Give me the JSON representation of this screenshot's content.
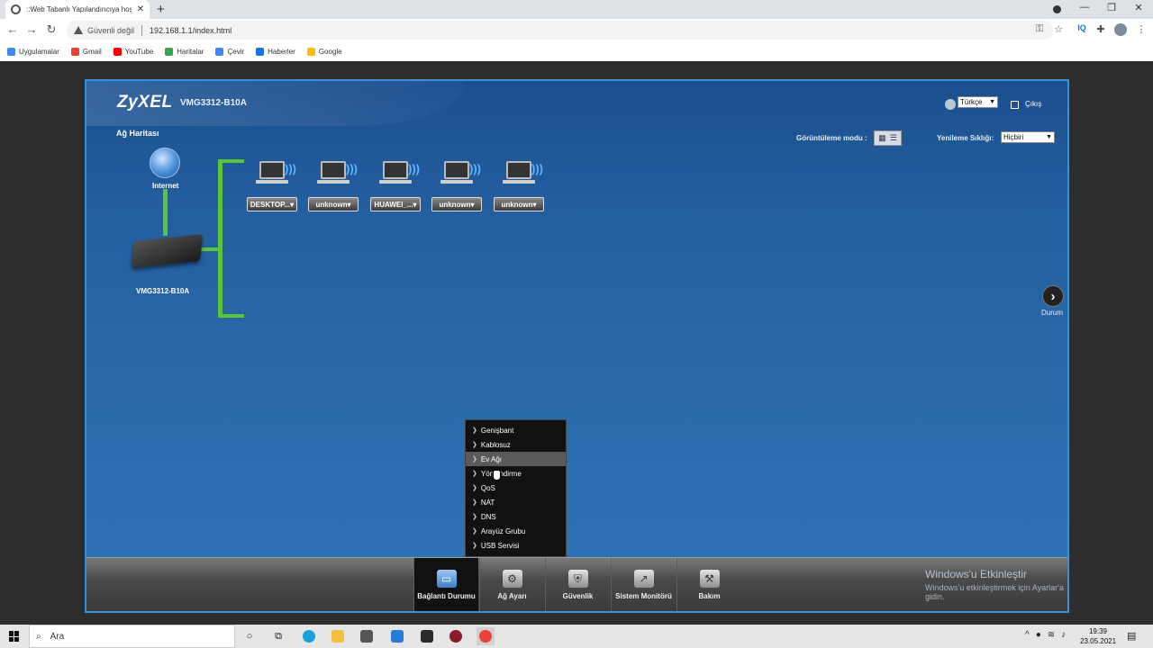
{
  "browser": {
    "tab_title": "::Web Tabanlı Yapılandırıcıya hoş",
    "tab_close": "✕",
    "new_tab": "+",
    "security_label": "Güvenli değil",
    "url": "192.168.1.1/index.html",
    "iq": "IQ",
    "window_controls": [
      "—",
      "❐",
      "✕"
    ],
    "bookmarks": [
      {
        "label": "Uygulamalar",
        "color": "#4285f4"
      },
      {
        "label": "Gmail",
        "color": "#ea4335"
      },
      {
        "label": "YouTube",
        "color": "#ff0000"
      },
      {
        "label": "Haritalar",
        "color": "#34a853"
      },
      {
        "label": "Çevir",
        "color": "#4285f4"
      },
      {
        "label": "Haberler",
        "color": "#1a73e8"
      },
      {
        "label": "Google",
        "color": "#fbbc05"
      }
    ]
  },
  "router": {
    "brand": "ZyXEL",
    "model": "VMG3312-B10A",
    "language": "Türkçe",
    "logout": "Çıkış",
    "map_title": "Ağ Haritası",
    "view_mode_label": "Görüntüleme modu :",
    "refresh_label": "Yenileme Sıklığı:",
    "refresh_value": "Hiçbiri",
    "internet_label": "Internet",
    "router_label": "VMG3312-B10A",
    "devices": [
      "DESKTOP...▾",
      "unknown▾",
      "HUAWEI_...▾",
      "unknown▾",
      "unknown▾"
    ],
    "status_label": "Durum",
    "popup_menu": [
      {
        "label": "Genişbant",
        "selected": false
      },
      {
        "label": "Kablosuz",
        "selected": false
      },
      {
        "label": "Ev Ağı",
        "selected": true
      },
      {
        "label": "Yönlendirme",
        "selected": false
      },
      {
        "label": "QoS",
        "selected": false
      },
      {
        "label": "NAT",
        "selected": false
      },
      {
        "label": "DNS",
        "selected": false
      },
      {
        "label": "Arayüz Grubu",
        "selected": false
      },
      {
        "label": "USB Servisi",
        "selected": false
      }
    ],
    "bottom_nav": [
      {
        "label": "Bağlantı Durumu",
        "icon": "monitor-icon",
        "active": true
      },
      {
        "label": "Ağ Ayarı",
        "icon": "gear-icon",
        "active": false
      },
      {
        "label": "Güvenlik",
        "icon": "shield-icon",
        "active": false
      },
      {
        "label": "Sistem Monitörü",
        "icon": "chart-icon",
        "active": false
      },
      {
        "label": "Bakım",
        "icon": "tools-icon",
        "active": false
      }
    ],
    "win_activate_title": "Windows'u Etkinleştir",
    "win_activate_sub": "Windows'u etkinleştirmek için Ayarlar'a gidin."
  },
  "taskbar": {
    "search_placeholder": "Ara",
    "time": "19:39",
    "date": "23.05.2021"
  },
  "colors": {
    "accent_blue": "#2a6aab",
    "line_green": "#5ac43a",
    "frame_border": "#3a8fd6"
  }
}
